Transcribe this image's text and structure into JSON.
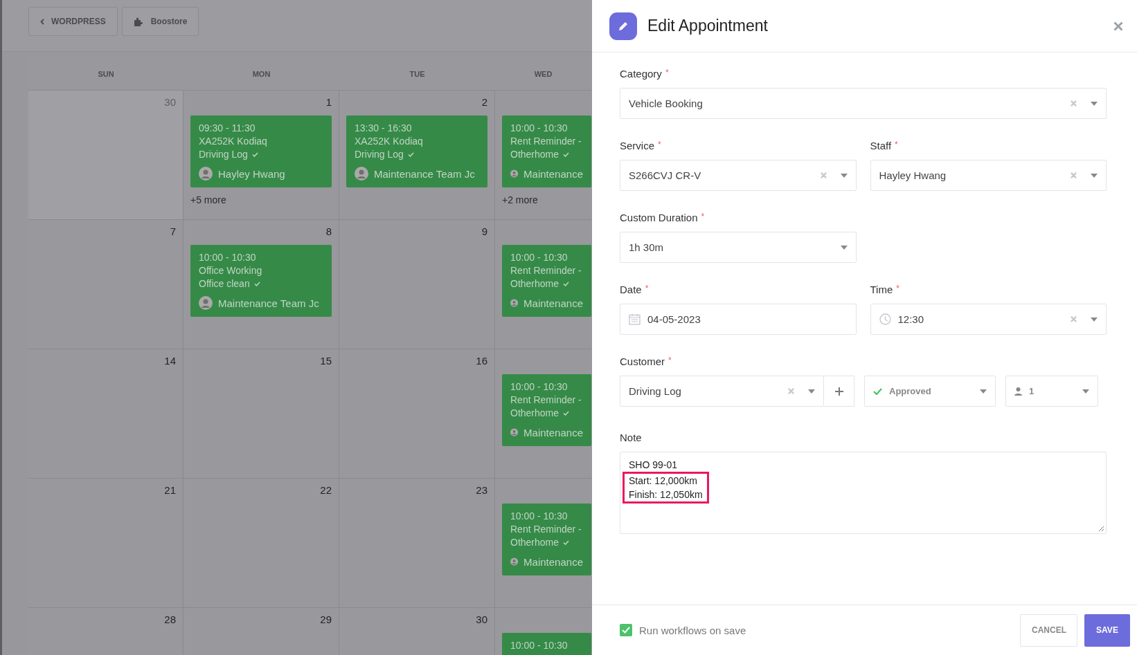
{
  "toolbar": {
    "buttons": [
      {
        "kind": "back",
        "label": "WORDPRESS"
      },
      {
        "kind": "plugin",
        "label": "Boostore"
      }
    ]
  },
  "calendar": {
    "weekdays": [
      {
        "label": "SUN"
      },
      {
        "label": "MON"
      },
      {
        "label": "TUE"
      },
      {
        "label": "WED"
      }
    ],
    "weeks": [
      {
        "days": [
          {
            "date": "30",
            "outside": true
          },
          {
            "date": "1",
            "events": [
              {
                "time": "09:30 - 11:30",
                "title": "XA252K Kodiaq",
                "subtitle": "Driving Log",
                "confirmed": true,
                "person": "Hayley Hwang"
              }
            ],
            "more": "+5 more"
          },
          {
            "date": "2",
            "events": [
              {
                "time": "13:30 - 16:30",
                "title": "XA252K Kodiaq",
                "subtitle": "Driving Log",
                "confirmed": true,
                "person": "Maintenance Team Jc"
              }
            ]
          },
          {
            "events": [
              {
                "time": "10:00 - 10:30",
                "title": "Rent Reminder -",
                "subtitle": "Otherhome",
                "confirmed": true,
                "person": "Maintenance"
              }
            ],
            "more": "+2 more"
          }
        ]
      },
      {
        "days": [
          {
            "date": "7"
          },
          {
            "date": "8",
            "events": [
              {
                "time": "10:00 - 10:30",
                "title": "Office Working",
                "subtitle": "Office clean",
                "confirmed": true,
                "person": "Maintenance Team Jc"
              }
            ]
          },
          {
            "date": "9"
          },
          {
            "events": [
              {
                "time": "10:00 - 10:30",
                "title": "Rent Reminder -",
                "subtitle": "Otherhome",
                "confirmed": true,
                "person": "Maintenance"
              }
            ]
          }
        ]
      },
      {
        "days": [
          {
            "date": "14"
          },
          {
            "date": "15"
          },
          {
            "date": "16"
          },
          {
            "events": [
              {
                "time": "10:00 - 10:30",
                "title": "Rent Reminder -",
                "subtitle": "Otherhome",
                "confirmed": true,
                "person": "Maintenance"
              }
            ]
          }
        ]
      },
      {
        "days": [
          {
            "date": "21"
          },
          {
            "date": "22"
          },
          {
            "date": "23"
          },
          {
            "events": [
              {
                "time": "10:00 - 10:30",
                "title": "Rent Reminder -",
                "subtitle": "Otherhome",
                "confirmed": true,
                "person": "Maintenance"
              }
            ]
          }
        ]
      },
      {
        "days": [
          {
            "date": "28"
          },
          {
            "date": "29"
          },
          {
            "date": "30"
          },
          {
            "events": [
              {
                "time": "10:00 - 10:30"
              }
            ]
          }
        ]
      }
    ]
  },
  "panel": {
    "title": "Edit Appointment",
    "rows": [
      {
        "fields": [
          {
            "kind": "select",
            "label": "Category",
            "required_mark": "*",
            "value": "Vehicle Booking",
            "clearable": true,
            "wide": true
          }
        ]
      },
      {
        "fields": [
          {
            "kind": "select",
            "label": "Service",
            "required_mark": "*",
            "value": "S266CVJ CR-V",
            "clearable": true,
            "wide": false
          },
          {
            "kind": "select",
            "label": "Staff",
            "required_mark": "*",
            "value": "Hayley Hwang",
            "clearable": true,
            "wide": false
          }
        ]
      },
      {
        "fields": [
          {
            "kind": "select",
            "label": "Custom Duration",
            "required_mark": "*",
            "value": "1h 30m",
            "clearable": false,
            "wide": false
          }
        ]
      },
      {
        "fields": [
          {
            "kind": "date",
            "label": "Date",
            "required_mark": "*",
            "value": "04-05-2023",
            "clearable": false,
            "wide": false
          },
          {
            "kind": "time",
            "label": "Time",
            "required_mark": "*",
            "value": "12:30",
            "clearable": true,
            "wide": false
          }
        ]
      }
    ],
    "customer": {
      "label": "Customer",
      "required_mark": "*",
      "value": "Driving Log",
      "clearable": true,
      "status": "Approved",
      "count": "1"
    },
    "note": {
      "label": "Note",
      "lines": [
        {
          "text": "SHO 99-01",
          "highlighted": false
        },
        {
          "text": "Start: 12,000km",
          "highlighted": true
        },
        {
          "text": "Finish: 12,050km",
          "highlighted": true
        }
      ]
    },
    "footer": {
      "run_workflows": {
        "label": "Run workflows on save",
        "checked": true
      },
      "buttons": [
        {
          "kind": "secondary",
          "label": "CANCEL"
        },
        {
          "kind": "primary",
          "label": "SAVE"
        }
      ]
    }
  }
}
